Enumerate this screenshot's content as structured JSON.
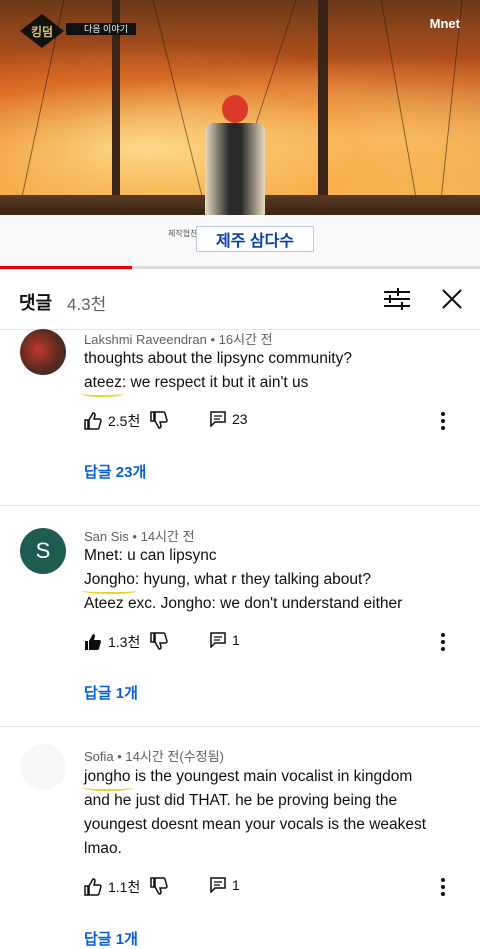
{
  "video": {
    "show_badge": "킹덤",
    "next_label": "다음 이야기",
    "channel": "Mnet",
    "sponsor_prefix": "제작협찬",
    "sponsor_name": "제주 삼다수",
    "progress": 0.275
  },
  "comments_header": {
    "title": "댓글",
    "count": "4.3천"
  },
  "comments": [
    {
      "author": "Lakshmi Raveendran",
      "time": "16시간 전",
      "lines": [
        {
          "pre": "",
          "hl": "",
          "post": "thoughts about the lipsync community?"
        },
        {
          "pre": "",
          "hl": "ateez",
          "post": ": we respect it but it ain't us"
        }
      ],
      "likes": "2.5천",
      "replies_count": "23",
      "reply_link": "답글 23개",
      "liked": false
    },
    {
      "author": "San Sis",
      "time": "14시간 전",
      "avatar_letter": "S",
      "lines": [
        {
          "pre": "",
          "hl": "",
          "post": "Mnet: u can lipsync"
        },
        {
          "pre": "",
          "hl": "Jongho",
          "post": ": hyung, what r they talking about?"
        },
        {
          "pre": "",
          "hl": "",
          "post": "Ateez exc. Jongho: we don't understand either"
        }
      ],
      "likes": "1.3천",
      "replies_count": "1",
      "reply_link": "답글 1개",
      "liked": true
    },
    {
      "author": "Sofia",
      "time": "14시간 전(수정됨)",
      "lines": [
        {
          "pre": "",
          "hl": "jongho",
          "post": " is the youngest main vocalist in kingdom"
        },
        {
          "pre": "",
          "hl": "",
          "post": "and he just did THAT. he be proving being the"
        },
        {
          "pre": "",
          "hl": "",
          "post": "youngest doesnt mean your vocals is the weakest"
        },
        {
          "pre": "",
          "hl": "",
          "post": "lmao."
        }
      ],
      "likes": "1.1천",
      "replies_count": "1",
      "reply_link": "답글 1개",
      "liked": false
    }
  ],
  "colors": {
    "link": "#065fd4",
    "highlight": "#e8d42a",
    "avatar_s": "#1e5c52",
    "progress": "#e00000"
  }
}
